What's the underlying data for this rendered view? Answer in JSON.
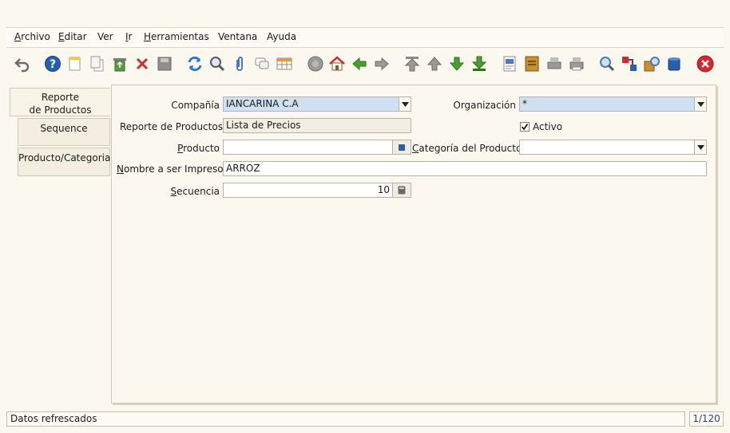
{
  "menu": {
    "items": [
      {
        "mnemonic": "A",
        "rest": "rchivo"
      },
      {
        "mnemonic": "E",
        "rest": "ditar"
      },
      {
        "mnemonic": "",
        "rest": "Ver"
      },
      {
        "mnemonic": "I",
        "rest": "r"
      },
      {
        "mnemonic": "H",
        "rest": "erramientas"
      },
      {
        "mnemonic": "",
        "rest": "Ventana"
      },
      {
        "mnemonic": "",
        "rest": "Ayuda"
      }
    ]
  },
  "tabs": [
    {
      "line1": "Reporte",
      "line2": "de Productos"
    },
    {
      "line1": "Sequence",
      "line2": ""
    },
    {
      "line1": "Producto/Categoria",
      "line2": ""
    }
  ],
  "form": {
    "company_label": "Compañía",
    "company_value": "IANCARINA C.A",
    "organization_label": "Organización",
    "organization_value": "*",
    "product_report_label": "Reporte de Productos",
    "product_report_value": "Lista de Precios",
    "active_label": "Activo",
    "active_checked": true,
    "product_label_mn": "P",
    "product_label_rest": "roducto",
    "product_value": "",
    "category_label_mn": "C",
    "category_label_rest": "ategoría del Producto",
    "category_value": "",
    "print_name_label_mn": "N",
    "print_name_label_rest": "ombre a ser Impreso",
    "print_name_value": "ARROZ",
    "sequence_label_mn": "S",
    "sequence_label_rest": "ecuencia",
    "sequence_value": "10"
  },
  "status": {
    "message": "Datos refrescados",
    "record_count": "1/120"
  },
  "colors": {
    "accent_blue": "#cfe0f2",
    "toolbar_green": "#4aa02c",
    "close_red": "#d8262c"
  }
}
